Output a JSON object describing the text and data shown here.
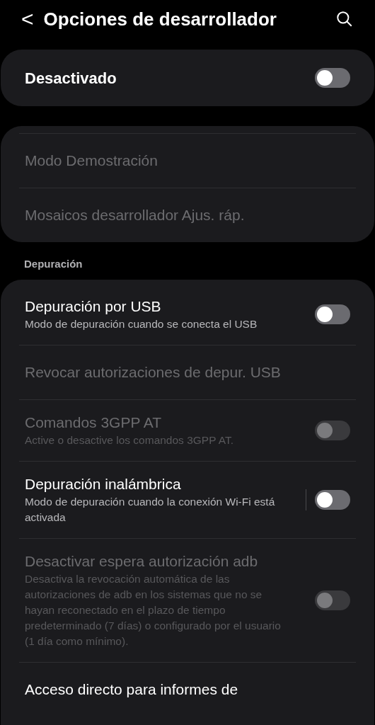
{
  "header": {
    "back": "<",
    "title": "Opciones de desarrollador"
  },
  "master": {
    "label": "Desactivado",
    "on": false
  },
  "group_1": {
    "items": [
      {
        "kind": "plain",
        "title": "Modo Demostración",
        "disabled": true
      },
      {
        "kind": "plain",
        "title": "Mosaicos desarrollador Ajus. ráp.",
        "disabled": true
      }
    ]
  },
  "section": {
    "title": "Depuración"
  },
  "group_2": {
    "items": [
      {
        "kind": "toggle",
        "title": "Depuración por USB",
        "subtitle": "Modo de depuración cuando se conecta el USB",
        "disabled": false,
        "on": false
      },
      {
        "kind": "plain",
        "title": "Revocar autorizaciones de depur. USB",
        "disabled": true
      },
      {
        "kind": "toggle",
        "title": "Comandos 3GPP AT",
        "subtitle": "Active o desactive los comandos 3GPP AT.",
        "disabled": true,
        "on": false
      },
      {
        "kind": "split_toggle",
        "title": "Depuración inalámbrica",
        "subtitle": "Modo de depuración cuando la conexión Wi-Fi está activada",
        "disabled": false,
        "on": false
      },
      {
        "kind": "toggle",
        "title": "Desactivar espera autorización adb",
        "subtitle": "Desactiva la revocación automática de las autorizaciones de adb en los sistemas que no se hayan reconectado en el plazo de tiempo predeterminado (7 días) o configurado por el usuario (1 día como mínimo).",
        "disabled": true,
        "on": false
      },
      {
        "kind": "plain",
        "title": "Acceso directo para informes de",
        "disabled": false
      }
    ]
  }
}
